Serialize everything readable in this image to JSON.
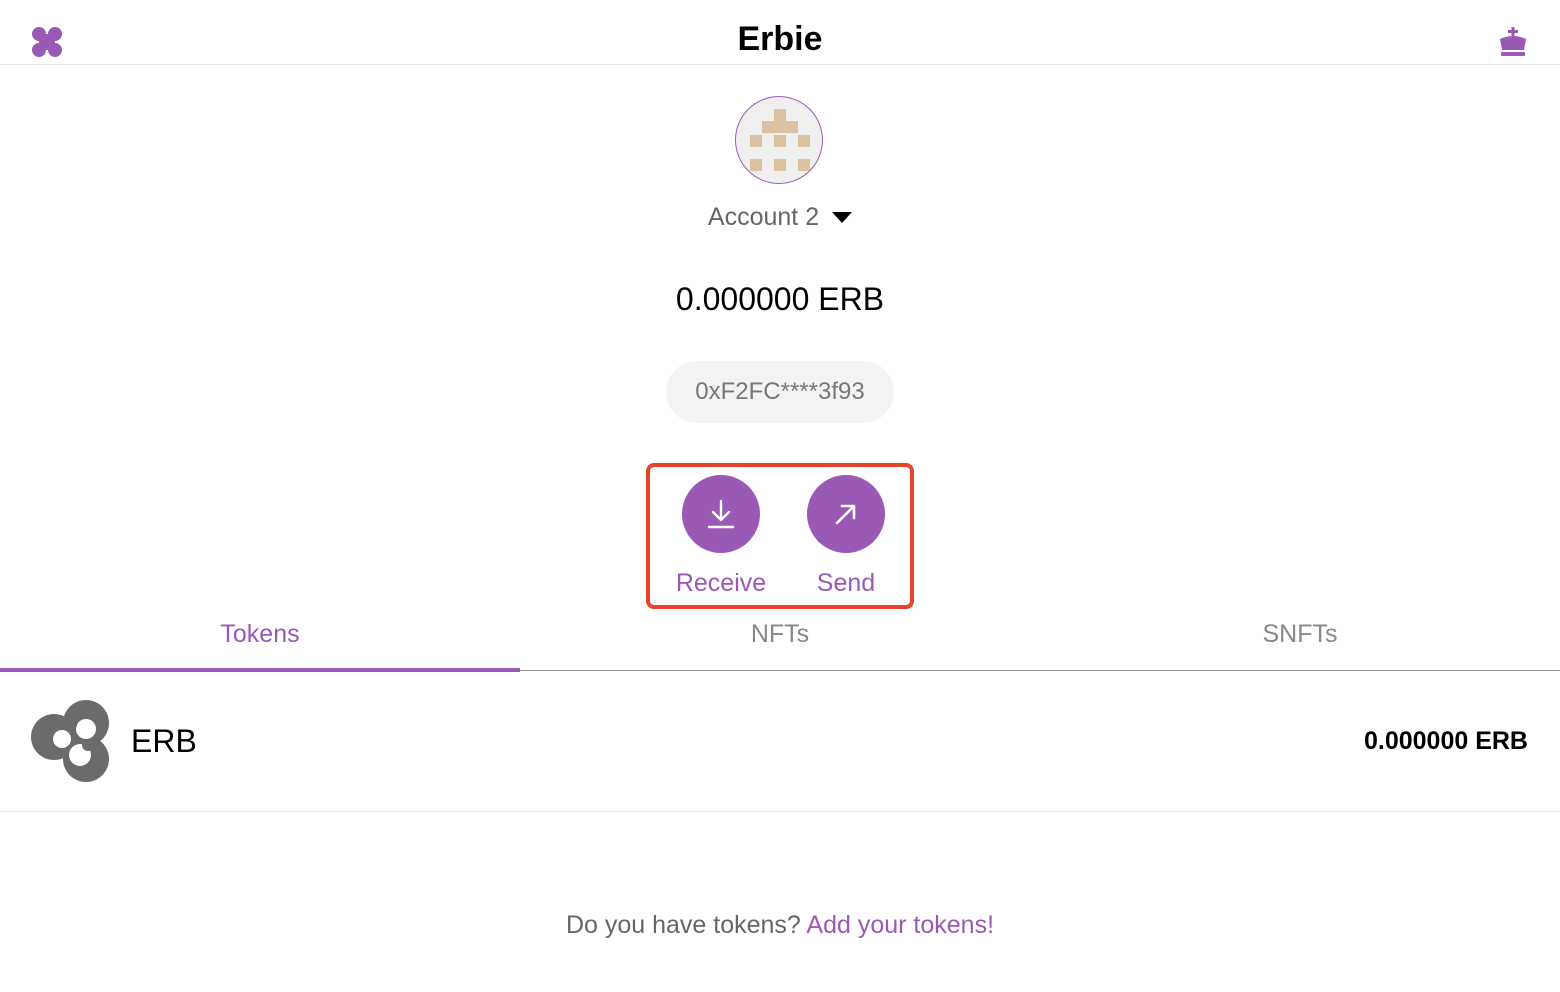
{
  "header": {
    "title": "Erbie",
    "menu_icon": "four-leaf-menu-icon",
    "crown_icon": "crown-icon",
    "accent_color": "#9b59b6"
  },
  "account": {
    "name": "Account 2",
    "balance": "0.000000 ERB",
    "address": "0xF2FC****3f93"
  },
  "actions": {
    "receive_label": "Receive",
    "send_label": "Send"
  },
  "tabs": [
    {
      "label": "Tokens",
      "active": true
    },
    {
      "label": "NFTs",
      "active": false
    },
    {
      "label": "SNFTs",
      "active": false
    }
  ],
  "tokens": [
    {
      "symbol": "ERB",
      "balance": "0.000000 ERB"
    }
  ],
  "footer": {
    "question": "Do you have tokens?",
    "link": "Add your tokens!"
  },
  "highlight_color": "#e8412c"
}
